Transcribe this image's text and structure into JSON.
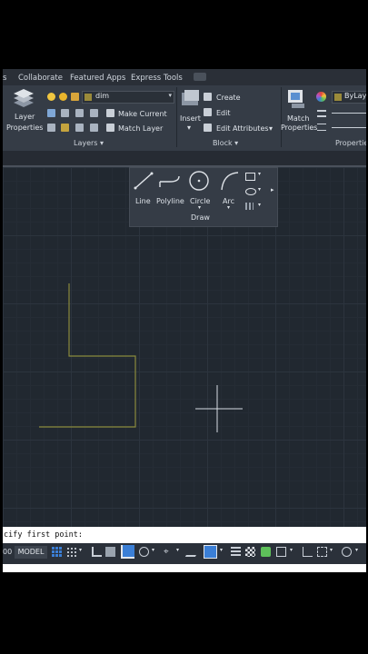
{
  "tabs": [
    "s",
    "Collaborate",
    "Featured Apps",
    "Express Tools"
  ],
  "layers": {
    "current_layer": "dim",
    "layer_properties_line1": "Layer",
    "layer_properties_line2": "Properties",
    "make_current": "Make Current",
    "match_layer": "Match Layer",
    "panel_title": "Layers ▾"
  },
  "block": {
    "insert": "Insert",
    "create": "Create",
    "edit": "Edit",
    "edit_attributes": "Edit Attributes",
    "panel_title": "Block ▾"
  },
  "properties": {
    "match_line1": "Match",
    "match_line2": "Properties",
    "bylayer": "ByLay",
    "panel_title": "Propertie"
  },
  "draw": {
    "line": "Line",
    "polyline": "Polyline",
    "circle": "Circle",
    "arc": "Arc",
    "panel_title": "Draw"
  },
  "command_line": "cify first point:",
  "status": {
    "coords": "00",
    "model": "MODEL"
  },
  "colors": {
    "background": "#212830",
    "ribbon": "#353c46",
    "layer_color_dim": "#9a8a3a",
    "drawn_line": "#8a8a3c",
    "accent": "#3b7fd6"
  }
}
